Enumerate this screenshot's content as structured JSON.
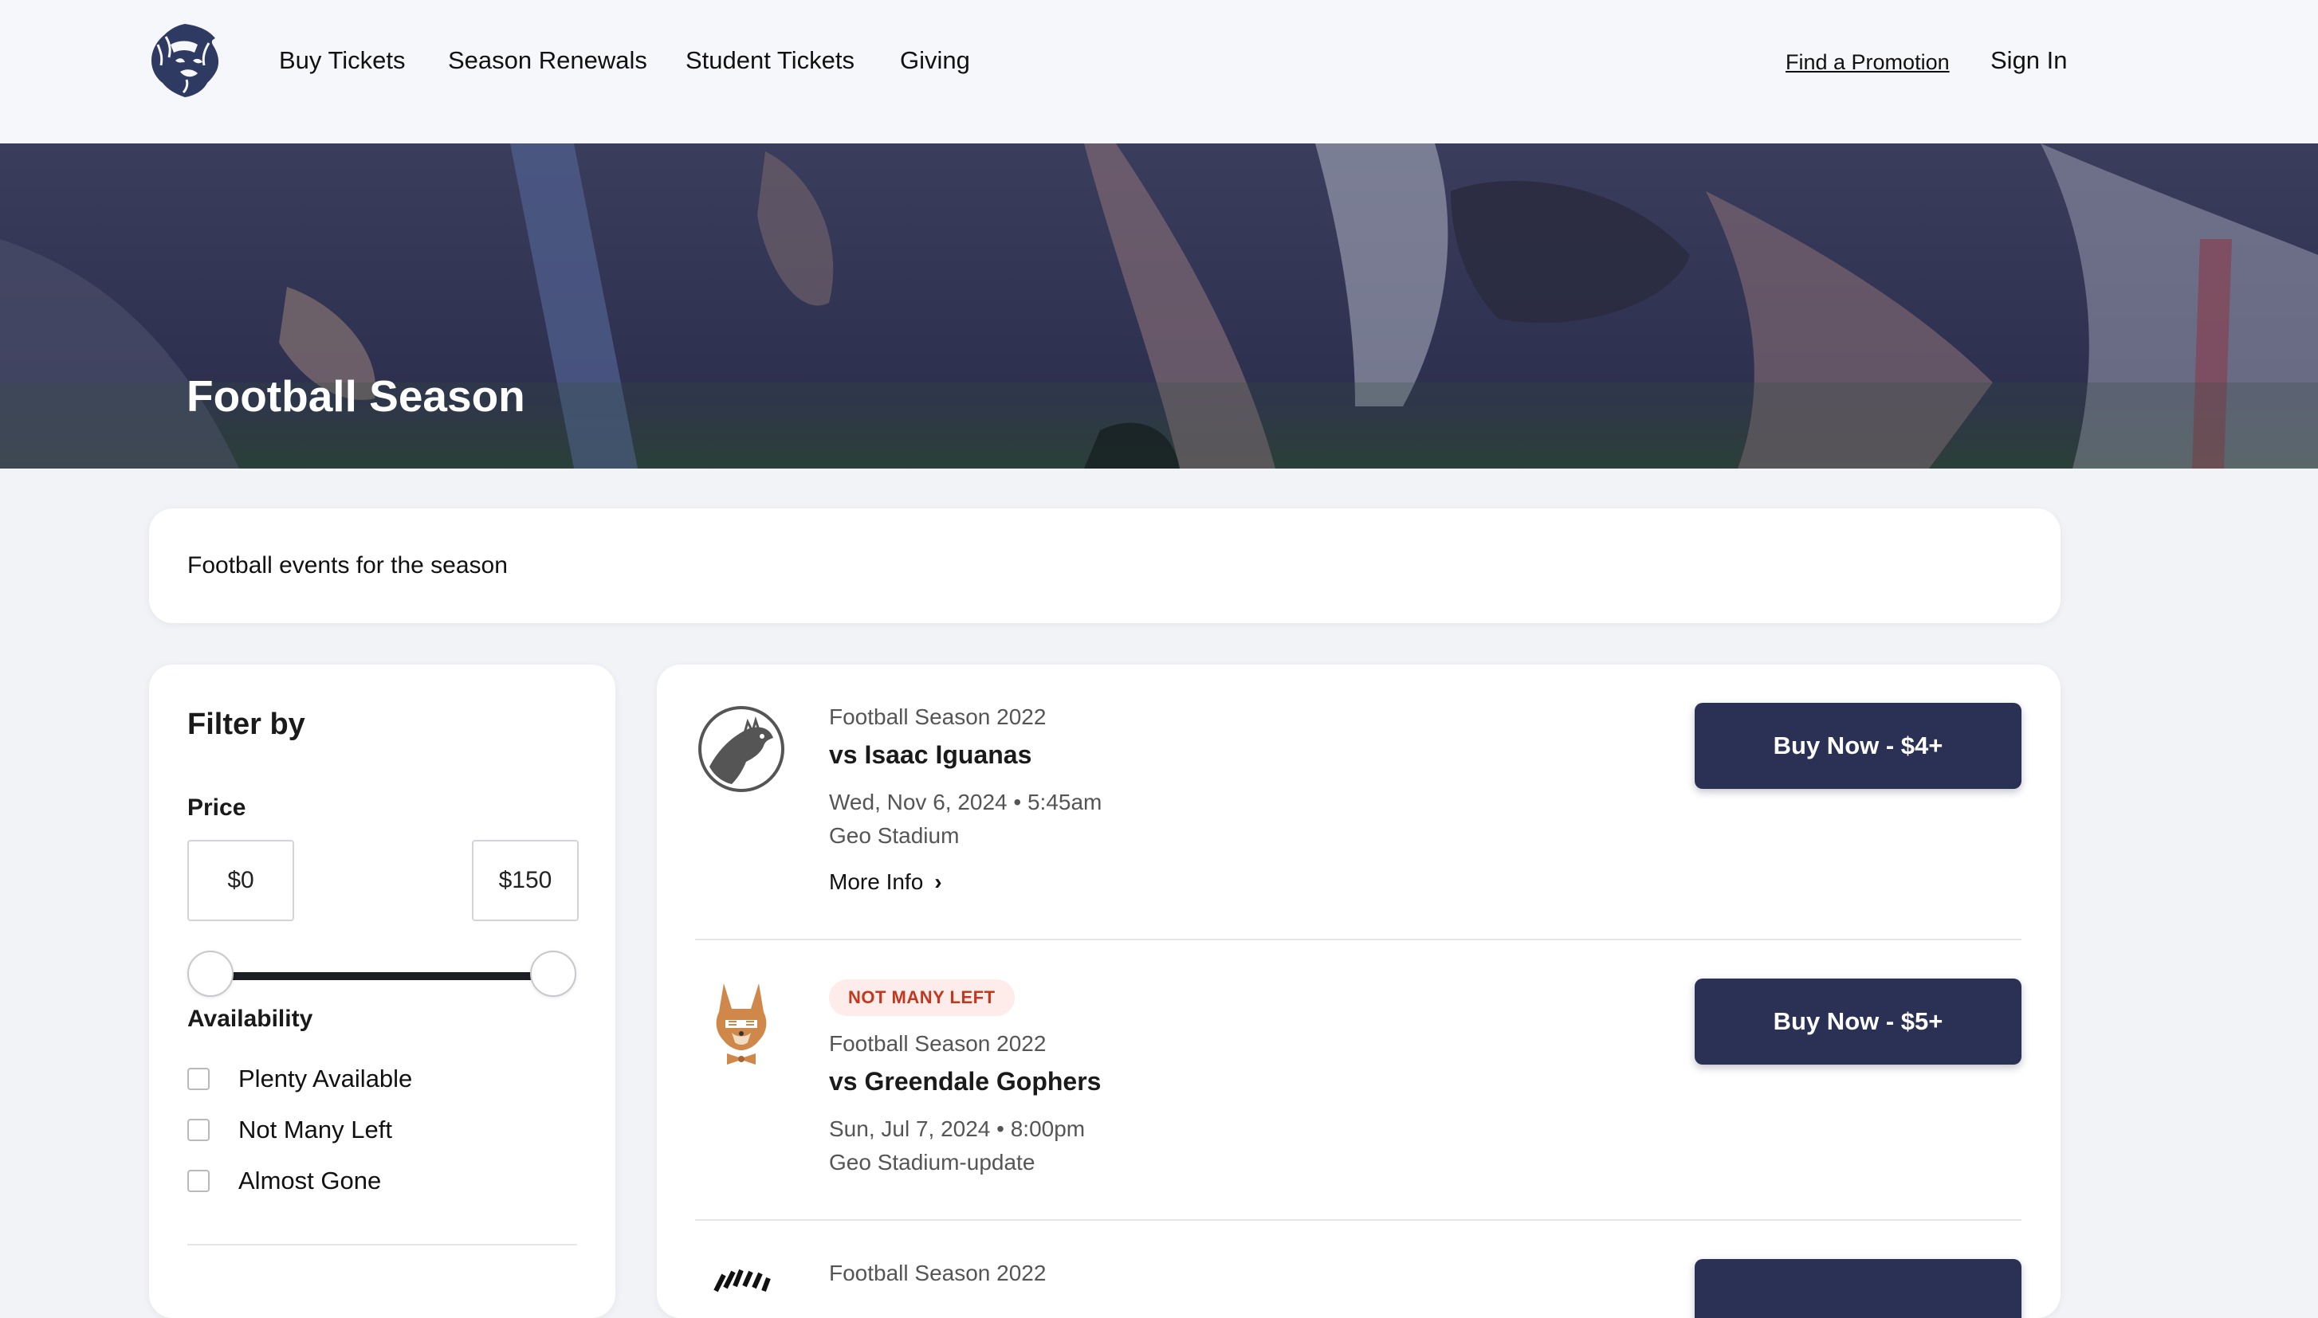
{
  "header": {
    "nav": [
      {
        "label": "Buy Tickets"
      },
      {
        "label": "Season Renewals"
      },
      {
        "label": "Student Tickets"
      },
      {
        "label": "Giving"
      }
    ],
    "promotion_link": "Find a Promotion",
    "sign_in": "Sign In"
  },
  "hero": {
    "title": "Football Season"
  },
  "description": "Football events for the season",
  "filter": {
    "title": "Filter by",
    "price_label": "Price",
    "price_min": "$0",
    "price_max": "$150",
    "availability_label": "Availability",
    "options": [
      {
        "label": "Plenty Available",
        "checked": false
      },
      {
        "label": "Not Many Left",
        "checked": false
      },
      {
        "label": "Almost Gone",
        "checked": false
      }
    ]
  },
  "events": [
    {
      "icon": "iguana-icon",
      "season": "Football Season 2022",
      "title": "vs Isaac Iguanas",
      "datetime": "Wed, Nov 6, 2024 • 5:45am",
      "venue": "Geo Stadium",
      "more_info": "More Info",
      "button": "Buy Now - $4+"
    },
    {
      "icon": "fox-icon",
      "badge": "NOT MANY LEFT",
      "season": "Football Season 2022",
      "title": "vs Greendale Gophers",
      "datetime": "Sun, Jul 7, 2024 • 8:00pm",
      "venue": "Geo Stadium-update",
      "button": "Buy Now - $5+"
    },
    {
      "icon": "zebra-icon",
      "season": "Football Season 2022"
    }
  ],
  "colors": {
    "primary_button": "#2a3154",
    "badge_bg": "#fdecea",
    "badge_text": "#c0391f",
    "page_bg": "#f2f3f7"
  }
}
